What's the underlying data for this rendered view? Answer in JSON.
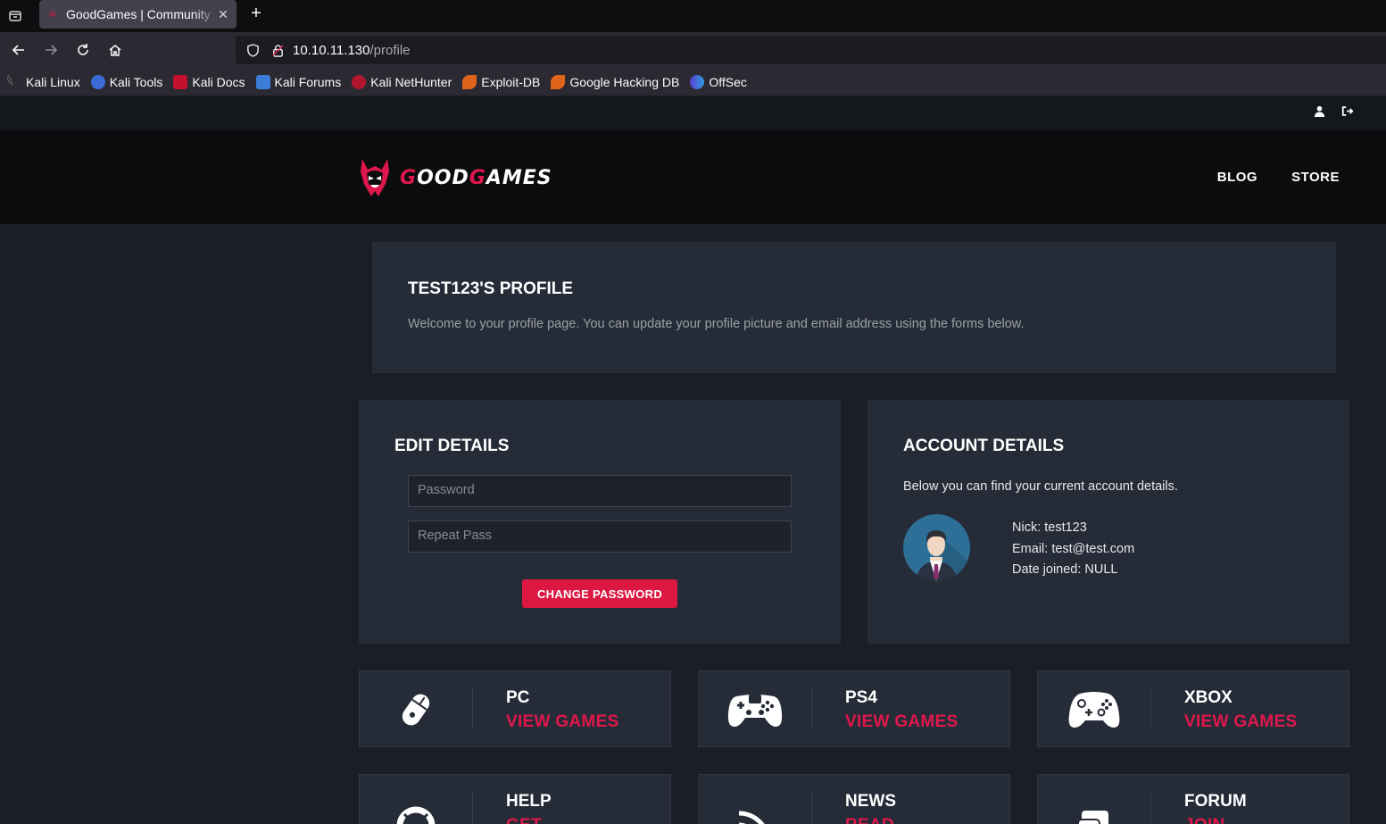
{
  "browser": {
    "tab_title": "GoodGames | Community",
    "url_host": "10.10.11.130",
    "url_path": "/profile",
    "bookmarks": [
      "Kali Linux",
      "Kali Tools",
      "Kali Docs",
      "Kali Forums",
      "Kali NetHunter",
      "Exploit-DB",
      "Google Hacking DB",
      "OffSec"
    ]
  },
  "site": {
    "logo_prefix": "G",
    "logo_mid": "OOD",
    "logo_g2": "G",
    "logo_suffix": "AMES",
    "nav": [
      "BLOG",
      "STORE"
    ]
  },
  "profile": {
    "title": "TEST123'S PROFILE",
    "description": "Welcome to your profile page. You can update your profile picture and email address using the forms below."
  },
  "edit": {
    "title": "EDIT DETAILS",
    "password_placeholder": "Password",
    "repeat_placeholder": "Repeat Pass",
    "button": "CHANGE PASSWORD"
  },
  "account": {
    "title": "ACCOUNT DETAILS",
    "description": "Below you can find your current account details.",
    "nick": "Nick: test123",
    "email": "Email: test@test.com",
    "joined": "Date joined: NULL"
  },
  "categories": [
    {
      "title": "PC",
      "link": "VIEW GAMES",
      "icon": "mouse-icon"
    },
    {
      "title": "PS4",
      "link": "VIEW GAMES",
      "icon": "ps-gamepad-icon"
    },
    {
      "title": "XBOX",
      "link": "VIEW GAMES",
      "icon": "xbox-gamepad-icon"
    },
    {
      "title": "HELP",
      "link": "GET",
      "icon": "lifebuoy-icon"
    },
    {
      "title": "NEWS",
      "link": "READ",
      "icon": "rss-icon"
    },
    {
      "title": "FORUM",
      "link": "JOIN",
      "icon": "chat-icon"
    }
  ],
  "colors": {
    "accent": "#dc1742",
    "panel": "#262c37",
    "background": "#1b1f25"
  }
}
